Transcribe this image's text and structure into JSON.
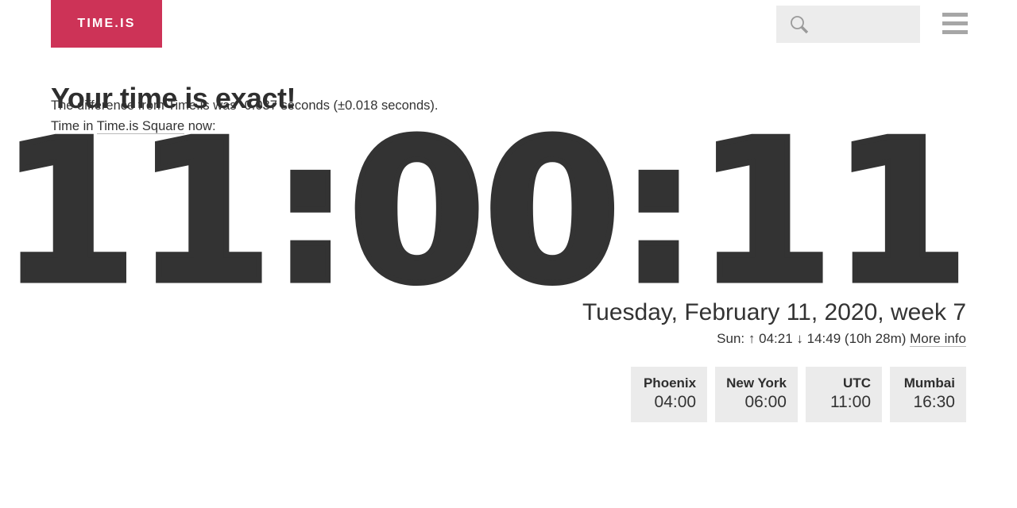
{
  "header": {
    "logo_text": "TIME.IS",
    "logo_color": "#cd3357",
    "search": {
      "placeholder": "",
      "value": "",
      "icon": "search-icon"
    },
    "menu_icon": "hamburger-menu-icon"
  },
  "main": {
    "headline": "Your time is exact!",
    "difference_text": "The difference from Time.is was -0.037 seconds (±0.018 seconds).",
    "location_prefix": "Time in ",
    "location_link": "Time.is Square",
    "location_suffix": " now:",
    "clock": "11:00:11",
    "date": "Tuesday, February 11, 2020, week 7",
    "sun": {
      "label": "Sun:",
      "sunrise_icon": "↑",
      "sunrise": "04:21",
      "sunset_icon": "↓",
      "sunset": "14:49",
      "daylength": "(10h 28m)",
      "more_info_link": "More info"
    },
    "cities": [
      {
        "name": "Phoenix",
        "time": "04:00"
      },
      {
        "name": "New York",
        "time": "06:00"
      },
      {
        "name": "UTC",
        "time": "11:00"
      },
      {
        "name": "Mumbai",
        "time": "16:30"
      }
    ]
  }
}
